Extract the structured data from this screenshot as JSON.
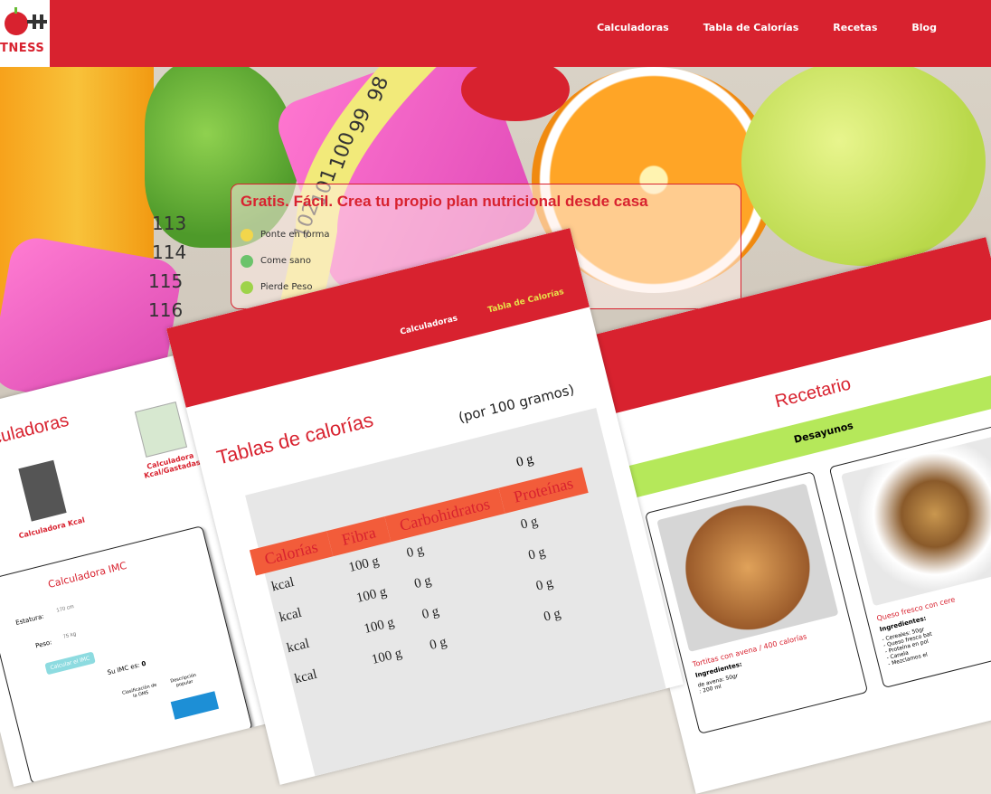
{
  "brand": {
    "logo_text": "TNESS"
  },
  "nav": {
    "items": [
      "Calculadoras",
      "Tabla de Calorías",
      "Recetas",
      "Blog"
    ]
  },
  "hero_card": {
    "title": "Gratis. Fácil. Crea tu propio plan nutricional desde casa",
    "items": [
      "Ponte en forma",
      "Come sano",
      "Pierde Peso"
    ]
  },
  "measuring_tape": [
    "98",
    "99",
    "100",
    "101",
    "102",
    "113",
    "114",
    "115",
    "116"
  ],
  "left_panel": {
    "title": "Calculadoras",
    "card1": "Calculadora Kcal",
    "card2": "Calculadora Kcal/Gastadas",
    "imc": {
      "title": "Calculadora IMC",
      "height_label": "Estatura:",
      "height_placeholder": "170 cm",
      "weight_label": "Peso:",
      "weight_placeholder": "75 kg",
      "button": "Calcular el IMC",
      "result": "Su IMC es:",
      "result_value": "0",
      "col1": "Clasificación de la OMS",
      "col2": "Descripción popular"
    }
  },
  "mid_panel": {
    "nav1": "Calculadoras",
    "nav2": "Tabla de Calorías",
    "title": "Tablas de calorías",
    "subtitle": "(por 100 gramos)",
    "headers": [
      "Calorías",
      "Fibra",
      "Carbohidratos",
      "Proteínas"
    ],
    "rows": [
      [
        "kcal",
        "100 g",
        "0 g",
        "0 g"
      ],
      [
        "kcal",
        "100 g",
        "0 g",
        "0 g"
      ],
      [
        "kcal",
        "100 g",
        "0 g",
        "0 g"
      ],
      [
        "kcal",
        "100 g",
        "0 g",
        "0 g"
      ]
    ],
    "top_protein": "0 g"
  },
  "right_panel": {
    "title": "Recetario",
    "section": "Desayunos",
    "recipe1": {
      "title": "Tortitas con avena / 400 calorías",
      "ing_label": "Ingredientes:",
      "lines": [
        "de avena: 50gr",
        ": 200 ml"
      ]
    },
    "recipe2": {
      "title": "Queso fresco con cere",
      "ing_label": "Ingredientes:",
      "lines": [
        "- Cereales: 50gr",
        "- Queso fresco bat",
        "- Proteína en pol",
        "- Canela",
        "- Mezclamos el"
      ]
    }
  }
}
